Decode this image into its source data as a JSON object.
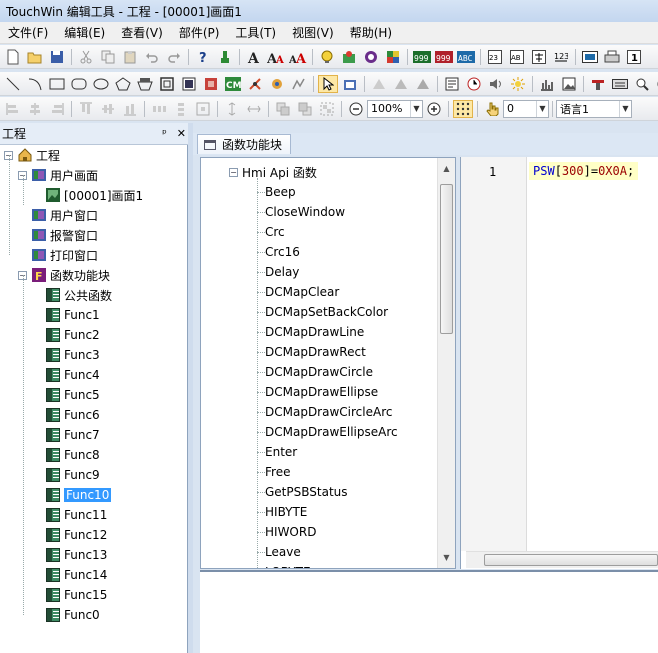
{
  "window": {
    "title": "TouchWin 编辑工具 - 工程 - [00001]画面1"
  },
  "menu": [
    "文件(F)",
    "编辑(E)",
    "查看(V)",
    "部件(P)",
    "工具(T)",
    "视图(V)",
    "帮助(H)"
  ],
  "toolbar": {
    "zoom_value": "100%",
    "number_value": "0",
    "language_value": "语言1"
  },
  "project_panel": {
    "title": "工程",
    "pin_label": "ᵖ",
    "close_label": "✕",
    "tree": [
      {
        "label": "工程",
        "indent": 0,
        "icon": "home-icon",
        "exp": "−"
      },
      {
        "label": "用户画面",
        "indent": 1,
        "icon": "screen-icon",
        "exp": "−"
      },
      {
        "label": "[00001]画面1",
        "indent": 2,
        "icon": "screen-page-icon",
        "exp": ""
      },
      {
        "label": "用户窗口",
        "indent": 1,
        "icon": "window-icon",
        "exp": ""
      },
      {
        "label": "报警窗口",
        "indent": 1,
        "icon": "alarm-window-icon",
        "exp": ""
      },
      {
        "label": "打印窗口",
        "indent": 1,
        "icon": "print-window-icon",
        "exp": ""
      },
      {
        "label": "函数功能块",
        "indent": 1,
        "icon": "function-block-icon",
        "exp": "−"
      },
      {
        "label": "公共函数",
        "indent": 2,
        "icon": "func-icon",
        "exp": ""
      },
      {
        "label": "Func1",
        "indent": 2,
        "icon": "func-icon",
        "exp": ""
      },
      {
        "label": "Func2",
        "indent": 2,
        "icon": "func-icon",
        "exp": ""
      },
      {
        "label": "Func3",
        "indent": 2,
        "icon": "func-icon",
        "exp": ""
      },
      {
        "label": "Func4",
        "indent": 2,
        "icon": "func-icon",
        "exp": ""
      },
      {
        "label": "Func5",
        "indent": 2,
        "icon": "func-icon",
        "exp": ""
      },
      {
        "label": "Func6",
        "indent": 2,
        "icon": "func-icon",
        "exp": ""
      },
      {
        "label": "Func7",
        "indent": 2,
        "icon": "func-icon",
        "exp": ""
      },
      {
        "label": "Func8",
        "indent": 2,
        "icon": "func-icon",
        "exp": ""
      },
      {
        "label": "Func9",
        "indent": 2,
        "icon": "func-icon",
        "exp": ""
      },
      {
        "label": "Func10",
        "indent": 2,
        "icon": "func-icon",
        "exp": "",
        "selected": true
      },
      {
        "label": "Func11",
        "indent": 2,
        "icon": "func-icon",
        "exp": ""
      },
      {
        "label": "Func12",
        "indent": 2,
        "icon": "func-icon",
        "exp": ""
      },
      {
        "label": "Func13",
        "indent": 2,
        "icon": "func-icon",
        "exp": ""
      },
      {
        "label": "Func14",
        "indent": 2,
        "icon": "func-icon",
        "exp": ""
      },
      {
        "label": "Func15",
        "indent": 2,
        "icon": "func-icon",
        "exp": ""
      },
      {
        "label": "Func0",
        "indent": 2,
        "icon": "func-icon",
        "exp": ""
      }
    ]
  },
  "editor": {
    "tab_label": "函数功能块",
    "api_root": "Hmi Api 函数",
    "api_items": [
      "Beep",
      "CloseWindow",
      "Crc",
      "Crc16",
      "Delay",
      "DCMapClear",
      "DCMapSetBackColor",
      "DCMapDrawLine",
      "DCMapDrawRect",
      "DCMapDrawCircle",
      "DCMapDrawEllipse",
      "DCMapDrawCircleArc",
      "DCMapDrawEllipseArc",
      "Enter",
      "Free",
      "GetPSBStatus",
      "HIBYTE",
      "HIWORD",
      "Leave",
      "LOBYTE"
    ],
    "line_number": "1",
    "code": {
      "reg": "PSW",
      "open": "[",
      "index": "300",
      "close": "]",
      "eq": "=",
      "value": "0X0A",
      "end": ";"
    }
  },
  "colors": {
    "selection": "#3399ff",
    "code_keyword": "#0000d0",
    "code_number": "#9b0000"
  }
}
